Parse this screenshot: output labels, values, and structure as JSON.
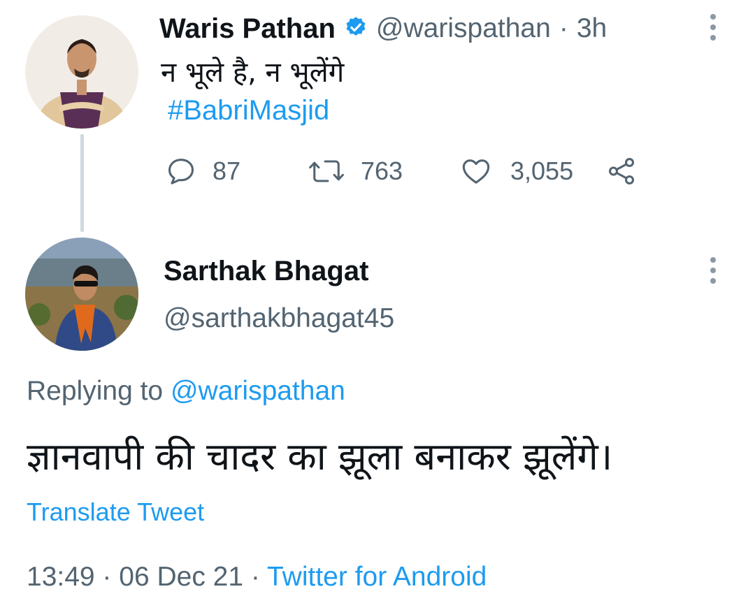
{
  "tweet": {
    "author_name": "Waris Pathan",
    "author_handle": "@warispathan",
    "separator": "·",
    "time": "3h",
    "text": "न भूले है, न भूलेंगे",
    "hashtag": "#BabriMasjid",
    "reply_count": "87",
    "retweet_count": "763",
    "like_count": "3,055"
  },
  "reply": {
    "author_name": "Sarthak Bhagat",
    "author_handle": "@sarthakbhagat45",
    "replying_to_prefix": "Replying to",
    "replying_to_handle": "@warispathan",
    "text": "ज्ञानवापी की चादर का झूला बनाकर झूलेंगे।",
    "translate_label": "Translate Tweet",
    "timestamp": "13:49 · 06 Dec 21 ·",
    "source": "Twitter for Android"
  },
  "colors": {
    "link": "#1d9bf0",
    "muted": "#536471",
    "verified": "#1d9bf0",
    "thread_line": "#cfd9de"
  },
  "icons": [
    "verified-badge-icon",
    "more-options-icon",
    "reply-icon",
    "retweet-icon",
    "like-icon",
    "share-icon"
  ]
}
